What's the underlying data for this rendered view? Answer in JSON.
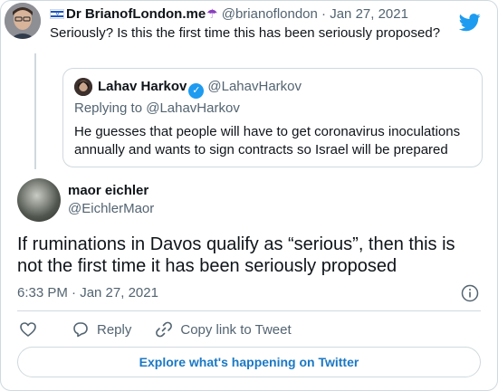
{
  "parent": {
    "display_name": "Dr BrianofLondon.me",
    "handle": "@brianoflondon",
    "separator": "·",
    "date": "Jan 27, 2021",
    "text": "Seriously? Is this the first time this has been seriously proposed?"
  },
  "quote": {
    "display_name": "Lahav Harkov",
    "handle": "@LahavHarkov",
    "replying_to": "Replying to @LahavHarkov",
    "text": "He guesses that people will have to get coronavirus inoculations annually and wants to sign contracts so Israel will be prepared"
  },
  "main": {
    "display_name": "maor eichler",
    "handle": "@EichlerMaor",
    "text": "If ruminations in Davos qualify as “serious”, then this is not the first time it has been seriously proposed",
    "time": "6:33 PM · Jan 27, 2021"
  },
  "actions": {
    "reply_label": "Reply",
    "copy_link_label": "Copy link to Tweet"
  },
  "footer": {
    "explore_label": "Explore what's happening on Twitter"
  },
  "colors": {
    "brand": "#1d9bf0",
    "text": "#0f1419",
    "muted": "#536471",
    "border": "#cfd9de",
    "link": "#1b78c4"
  },
  "icons": [
    "twitter-bird-icon",
    "verified-badge-icon",
    "info-icon",
    "heart-icon",
    "reply-icon",
    "link-icon",
    "israel-flag-icon",
    "umbrella-icon"
  ]
}
